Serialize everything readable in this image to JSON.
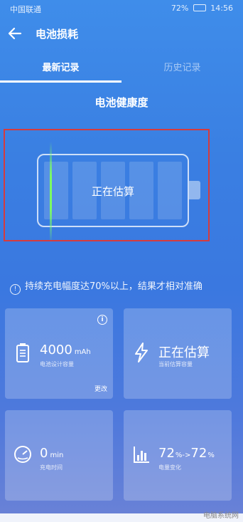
{
  "status_bar": {
    "carrier": "中国联通",
    "battery": "72%",
    "time": "14:56"
  },
  "header": {
    "title": "电池损耗"
  },
  "tabs": [
    {
      "label": "最新记录"
    },
    {
      "label": "历史记录"
    }
  ],
  "health": {
    "title": "电池健康度",
    "state": "正在估算"
  },
  "notice": {
    "text": "持续充电幅度达70%以上，结果才相对准确"
  },
  "cards": {
    "design_capacity": {
      "value": "4000",
      "unit": "mAh",
      "label": "电池设计容量",
      "edit_label": "更改",
      "info": "i"
    },
    "current_estimate": {
      "value": "正在估算",
      "label": "当前估算容量"
    },
    "charge_time": {
      "value": "0",
      "unit": "min",
      "label": "充电时间"
    },
    "charge_change": {
      "from": "72",
      "to": "72",
      "label": "电量变化"
    }
  },
  "watermark": "电脑系统网"
}
